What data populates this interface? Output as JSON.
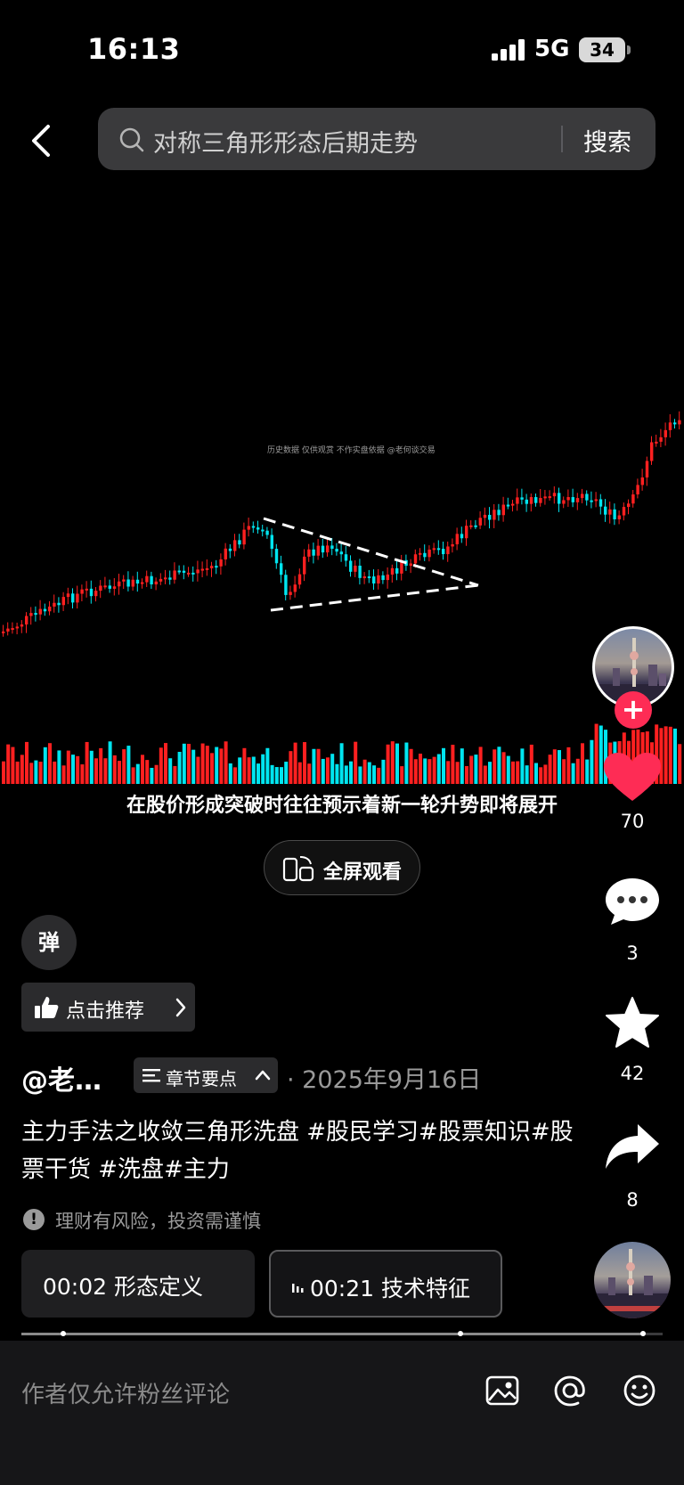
{
  "status_bar": {
    "time": "16:13",
    "network": "5G",
    "battery": "34"
  },
  "search": {
    "query": "对称三角形形态后期走势",
    "button_label": "搜索"
  },
  "video": {
    "watermark": "历史数据 仅供观赏 不作实盘依据 @老何谈交易",
    "subtitle": "在股价形成突破时往往预示着新一轮升势即将展开",
    "fullscreen_label": "全屏观看"
  },
  "rail": {
    "likes": "70",
    "comments": "3",
    "favorites": "42",
    "shares": "8"
  },
  "danmu_label": "弹",
  "recommend_label": "点击推荐",
  "author": "@老…",
  "chapter_button": "章节要点",
  "date": "· 2025年9月16日",
  "description": "主力手法之收敛三角形洗盘 #股民学习#股票知识#股票干货 #洗盘#主力",
  "risk_notice": "理财有风险，投资需谨慎",
  "chapters": [
    {
      "label": "00:02 形态定义"
    },
    {
      "label": "00:21 技术特征"
    }
  ],
  "progress": {
    "fraction": 0.97
  },
  "comment": {
    "placeholder": "作者仅允许粉丝评论"
  },
  "colors": {
    "accent": "#fe2c55",
    "up": "#ff2020",
    "down": "#00e5f0"
  }
}
